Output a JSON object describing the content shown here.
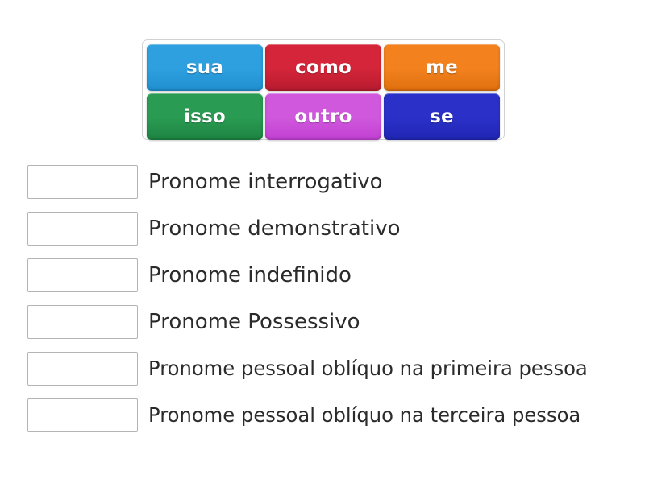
{
  "activity": {
    "type": "drag-and-drop-match",
    "language": "pt-BR"
  },
  "tiles": {
    "rows": [
      [
        {
          "label": "sua",
          "color": "#2e9fdf",
          "color_dark": "#1f8fd0",
          "name": "tile-sua"
        },
        {
          "label": "como",
          "color": "#d4253a",
          "color_dark": "#b81b2e",
          "name": "tile-como"
        },
        {
          "label": "me",
          "color": "#f2811e",
          "color_dark": "#e06f0d",
          "name": "tile-me"
        }
      ],
      [
        {
          "label": "isso",
          "color": "#2a9b52",
          "color_dark": "#1d8442",
          "name": "tile-isso"
        },
        {
          "label": "outro",
          "color": "#cf58dd",
          "color_dark": "#c23fd2",
          "name": "tile-outro"
        },
        {
          "label": "se",
          "color": "#2b31c8",
          "color_dark": "#2025b4",
          "name": "tile-se"
        }
      ]
    ]
  },
  "answers": {
    "rows": [
      {
        "label": "Pronome interrogativo",
        "condensed": false
      },
      {
        "label": "Pronome demonstrativo",
        "condensed": false
      },
      {
        "label": "Pronome indefinido",
        "condensed": false
      },
      {
        "label": "Pronome Possessivo",
        "condensed": false
      },
      {
        "label": "Pronome pessoal oblíquo na primeira pessoa",
        "condensed": true
      },
      {
        "label": "Pronome pessoal oblíquo na terceira pessoa",
        "condensed": true
      }
    ]
  },
  "colors": {
    "page_background": "#ffffff",
    "tray_border": "#d2d2d2",
    "drop_box_border": "#b4b4b4",
    "text": "#2b2b2b",
    "tile_text": "#ffffff"
  }
}
